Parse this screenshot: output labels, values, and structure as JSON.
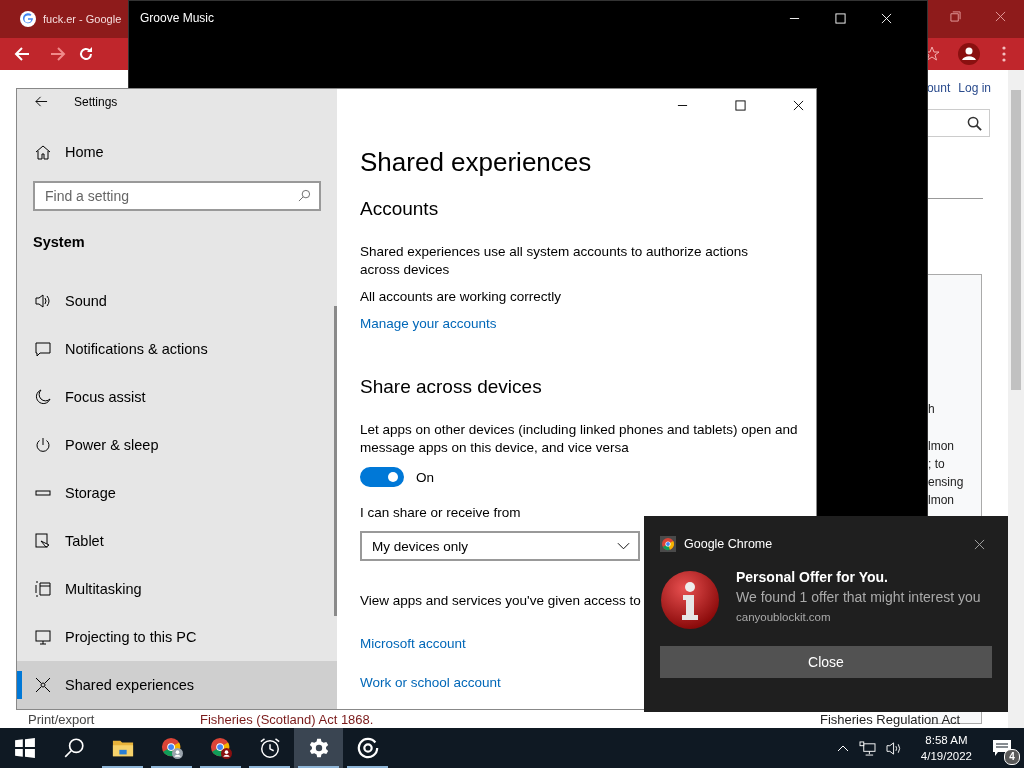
{
  "browser": {
    "tab_title": "fuck.er - Google",
    "header_links": [
      "ount",
      "Log in"
    ],
    "fragments": [
      "h",
      "lmon",
      "; to",
      "ensing",
      "lmon"
    ],
    "bottom_texts": [
      "Print/export",
      "Fisheries (Scotland) Act 1868.",
      "Fisheries Regulation Act"
    ]
  },
  "music_window": {
    "title": "Groove Music"
  },
  "settings": {
    "title": "Settings",
    "home": "Home",
    "search": {
      "placeholder": "Find a setting"
    },
    "section": "System",
    "nav": [
      {
        "label": "Sound",
        "kind": "sound",
        "selected": false
      },
      {
        "label": "Notifications & actions",
        "kind": "notifications",
        "selected": false
      },
      {
        "label": "Focus assist",
        "kind": "focus",
        "selected": false
      },
      {
        "label": "Power & sleep",
        "kind": "power",
        "selected": false
      },
      {
        "label": "Storage",
        "kind": "storage",
        "selected": false
      },
      {
        "label": "Tablet",
        "kind": "tablet",
        "selected": false
      },
      {
        "label": "Multitasking",
        "kind": "multitasking",
        "selected": false
      },
      {
        "label": "Projecting to this PC",
        "kind": "projecting",
        "selected": false
      },
      {
        "label": "Shared experiences",
        "kind": "shared",
        "selected": true
      }
    ],
    "page_title": "Shared experiences",
    "accounts": {
      "heading": "Accounts",
      "description": "Shared experiences use all system accounts to authorize actions across devices",
      "status": "All accounts are working correctly",
      "link": "Manage your accounts"
    },
    "share": {
      "heading": "Share across devices",
      "description": "Let apps on other devices (including linked phones and tablets) open and message apps on this device, and vice versa",
      "toggle": {
        "on": true,
        "label": "On"
      },
      "share_label": "I can share or receive from",
      "dropdown": {
        "value": "My devices only"
      },
      "access_text": "View apps and services you've given access to",
      "links": [
        "Microsoft account",
        "Work or school account"
      ]
    }
  },
  "notification": {
    "app": "Google Chrome",
    "title": "Personal Offer for You.",
    "body": "We found 1 offer that might interest you",
    "source": "canyoublockit.com",
    "button": "Close"
  },
  "taskbar": {
    "apps": [
      {
        "kind": "explorer",
        "running": true,
        "selected": false
      },
      {
        "kind": "chrome",
        "running": true,
        "selected": false
      },
      {
        "kind": "chrome-profile",
        "running": true,
        "selected": false
      },
      {
        "kind": "alarms",
        "running": true,
        "selected": false
      },
      {
        "kind": "settings",
        "running": true,
        "selected": true
      },
      {
        "kind": "groove",
        "running": true,
        "selected": false
      }
    ],
    "time": "8:58 AM",
    "date": "4/19/2022",
    "notification_count": "4"
  }
}
